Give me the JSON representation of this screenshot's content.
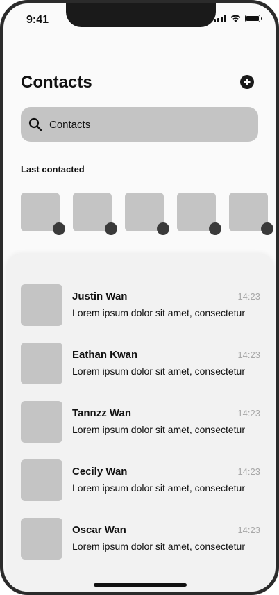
{
  "status_bar": {
    "time": "9:41"
  },
  "header": {
    "title": "Contacts",
    "add_icon": "plus-circle-icon"
  },
  "search": {
    "placeholder": "Contacts",
    "icon": "search-icon"
  },
  "last_contacted": {
    "label": "Last contacted",
    "count": 5
  },
  "contacts": [
    {
      "name": "Justin Wan",
      "time": "14:23",
      "message": "Lorem ipsum dolor sit amet, consectetur"
    },
    {
      "name": "Eathan Kwan",
      "time": "14:23",
      "message": "Lorem ipsum dolor sit amet, consectetur"
    },
    {
      "name": "Tannzz Wan",
      "time": "14:23",
      "message": "Lorem ipsum dolor sit amet, consectetur"
    },
    {
      "name": "Cecily Wan",
      "time": "14:23",
      "message": "Lorem ipsum dolor sit amet, consectetur"
    },
    {
      "name": "Oscar Wan",
      "time": "14:23",
      "message": "Lorem ipsum dolor sit amet, consectetur"
    }
  ]
}
